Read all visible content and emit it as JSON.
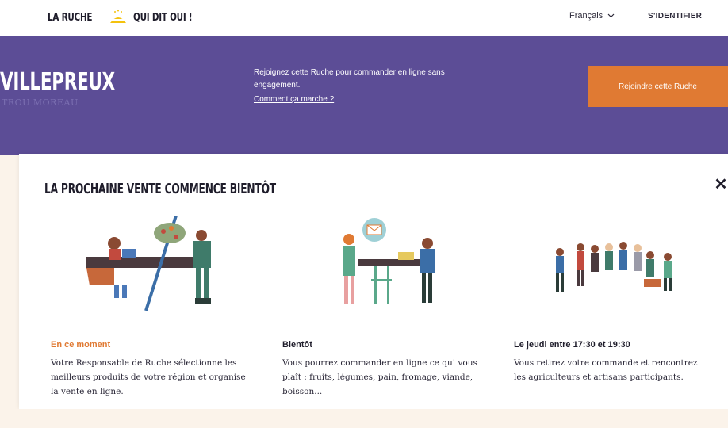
{
  "header": {
    "logo_left": "LA RUCHE",
    "logo_right": "QUI DIT OUI !",
    "language": "Français",
    "signin": "S'IDENTIFIER"
  },
  "hero": {
    "hive_name": "VILLEPREUX",
    "hive_location": "TROU MOREAU",
    "invite_text": "Rejoignez cette Ruche pour commander en ligne sans engagement.",
    "how_link": "Comment ça marche ?",
    "join_button": "Rejoindre cette Ruche"
  },
  "modal": {
    "title": "LA PROCHAINE VENTE COMMENCE BIENTÔT",
    "close": "✕",
    "steps": [
      {
        "title": "En ce moment",
        "title_color": "#e07a33",
        "description": "Votre Responsable de Ruche sélectionne les meilleurs produits de votre région et organise la vente en ligne."
      },
      {
        "title": "Bientôt",
        "title_color": "#1f1d2b",
        "description": "Vous pourrez commander en ligne ce qui vous plaît : fruits, légumes, pain, fromage, viande, boisson..."
      },
      {
        "title": "Le jeudi entre 17:30 et 19:30",
        "title_color": "#1f1d2b",
        "description": "Vous retirez votre commande et rencontrez les agriculteurs et artisans participants."
      }
    ]
  },
  "colors": {
    "purple": "#5c4d96",
    "orange": "#e07a33",
    "cream": "#fbf3ea"
  }
}
